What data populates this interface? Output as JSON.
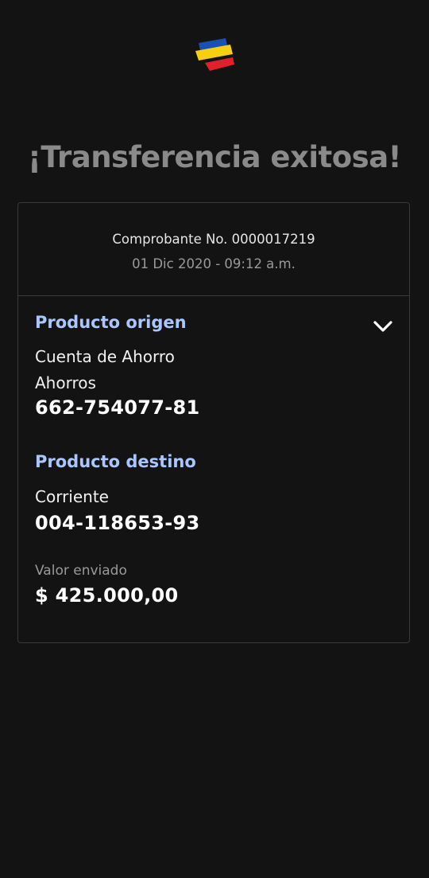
{
  "header": {
    "title": "¡Transferencia exitosa!",
    "logo_icon": "bank-flag-logo",
    "logo_colors": [
      "#1a4fb3",
      "#f6d010",
      "#e0212b"
    ]
  },
  "receipt": {
    "number_label": "Comprobante No. 0000017219",
    "date": "01 Dic 2020 - 09:12 a.m."
  },
  "origin": {
    "title": "Producto origen",
    "account_type": "Cuenta de Ahorro",
    "product": "Ahorros",
    "account_number": "662-754077-81",
    "toggle_icon": "chevron-down-icon"
  },
  "destination": {
    "title": "Producto destino",
    "product": "Corriente",
    "account_number": "004-118653-93"
  },
  "amount": {
    "label": "Valor enviado",
    "value": "$ 425.000,00"
  },
  "colors": {
    "background": "#131313",
    "accent": "#a9c6ff",
    "title": "#8a8a8a",
    "border": "#3a3a3a"
  }
}
